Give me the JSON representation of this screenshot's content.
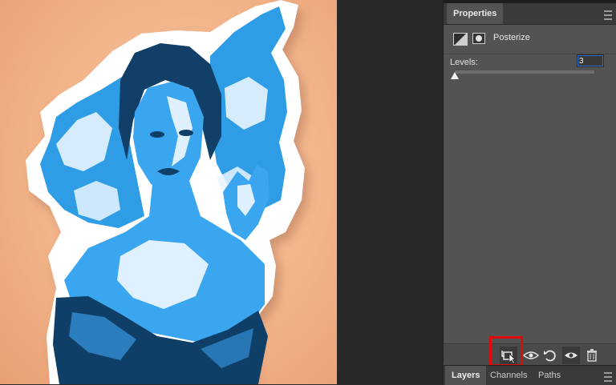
{
  "properties": {
    "tab_label": "Properties",
    "adjustment_name": "Posterize",
    "levels_label": "Levels:",
    "levels_value": "3",
    "levels_fraction": 0.0
  },
  "layers_panel": {
    "tabs": [
      {
        "label": "Layers"
      },
      {
        "label": "Channels"
      },
      {
        "label": "Paths"
      }
    ]
  },
  "colors": {
    "canvas_bg": "#f2b48a",
    "artwork_blue": "#2a9ae8",
    "artwork_dark": "#0f3e66",
    "highlight": "#e00a0a",
    "panel_bg": "#535353"
  },
  "icons": {
    "clip": "clip-to-layer-icon",
    "view_previous": "view-previous-state-icon",
    "reset": "reset-adjustments-icon",
    "visibility": "eye-icon",
    "delete": "trash-icon",
    "cursor": "hand-pointer-icon"
  }
}
